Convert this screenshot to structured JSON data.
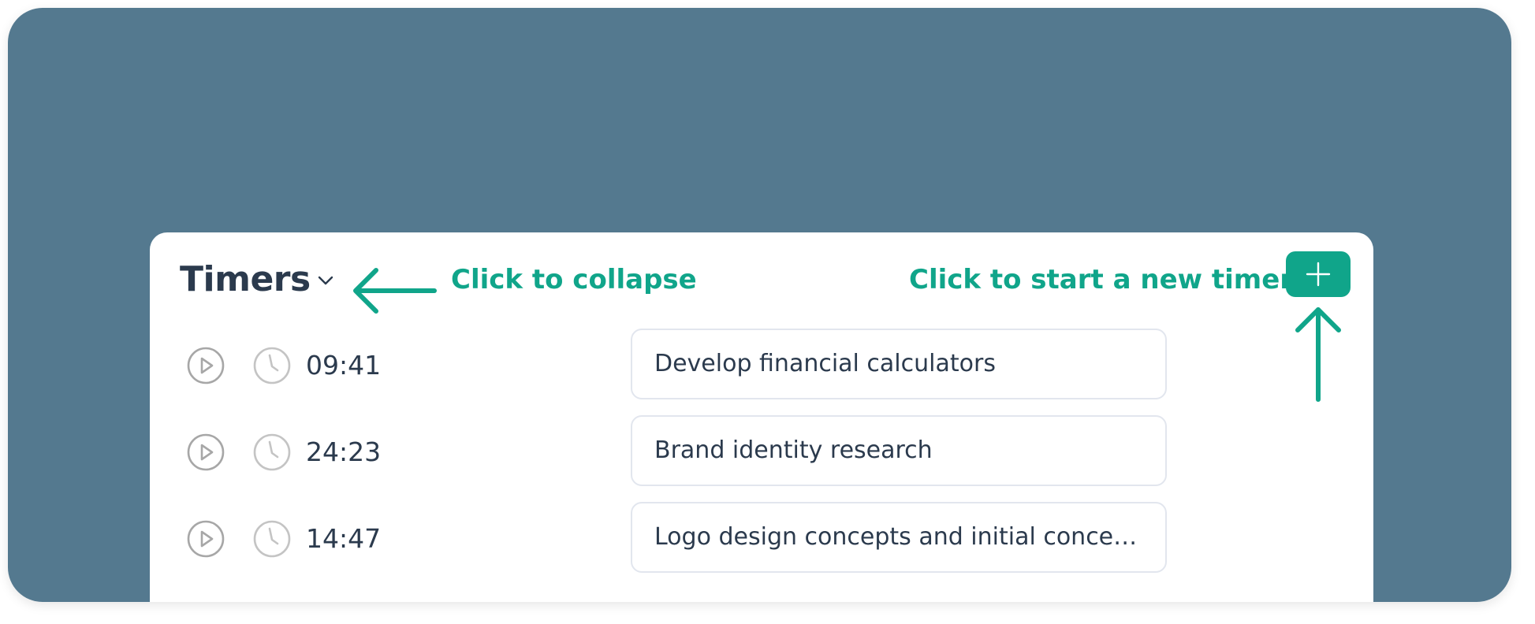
{
  "header": {
    "title": "Timers"
  },
  "annotations": {
    "collapse": "Click to collapse",
    "new_timer": "Click to start a new timer"
  },
  "colors": {
    "background": "#54798f",
    "accent": "#10a58a",
    "text": "#2b3a4d",
    "icon_gray": "#a7a7a7"
  },
  "icons": {
    "collapse": "chevron-down-icon",
    "add": "plus-icon",
    "play": "play-icon",
    "clock": "clock-icon"
  },
  "timers": [
    {
      "time": "09:41",
      "task": "Develop financial calculators"
    },
    {
      "time": "24:23",
      "task": "Brand identity research"
    },
    {
      "time": "14:47",
      "task": "Logo design concepts and initial concep..."
    }
  ]
}
